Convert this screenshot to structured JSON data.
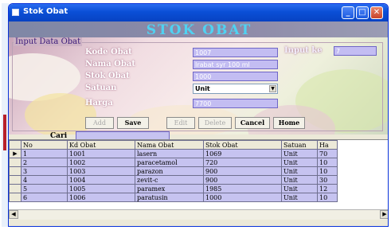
{
  "window": {
    "title": "Stok Obat"
  },
  "header": {
    "title": "STOK OBAT"
  },
  "form": {
    "group_label": "Input Data Obat",
    "labels": {
      "kode": "Kode Obat",
      "nama": "Nama Obat",
      "stok": "Stok Obat",
      "satuan": "Satuan",
      "harga": "Harga",
      "input": "Input ke",
      "cari": "Cari"
    },
    "values": {
      "kode": "1007",
      "nama": "Irabat syr 100 ml",
      "stok": "1000",
      "satuan": "Unit",
      "harga": "7700",
      "input": "7",
      "cari": ""
    }
  },
  "buttons": {
    "add": "Add",
    "save": "Save",
    "edit": "Edit",
    "delete": "Delete",
    "cancel": "Cancel",
    "home": "Home"
  },
  "table": {
    "columns": [
      "No",
      "Kd Obat",
      "Nama Obat",
      "Stok Obat",
      "Satuan",
      "Ha"
    ],
    "rows": [
      [
        "1",
        "1001",
        "lasern",
        "1069",
        "Unit",
        "70"
      ],
      [
        "2",
        "1002",
        "paracetamol",
        "720",
        "Unit",
        "10"
      ],
      [
        "3",
        "1003",
        "parazon",
        "900",
        "Unit",
        "10"
      ],
      [
        "4",
        "1004",
        "zevit-c",
        "900",
        "Unit",
        "30"
      ],
      [
        "5",
        "1005",
        "paramex",
        "1985",
        "Unit",
        "12"
      ],
      [
        "6",
        "1006",
        "paratusin",
        "1000",
        "Unit",
        "10"
      ]
    ],
    "current_row_marker": "▶"
  },
  "icons": {
    "app": "app-icon",
    "minimize": "minimize-icon",
    "maximize": "maximize-icon",
    "close": "close-icon"
  },
  "colors": {
    "title_bar": "#0a4fd6",
    "header_text": "#4fd2f2",
    "field_bg": "#c3bdf2",
    "grid_row_bg": "#c6c3f0"
  }
}
